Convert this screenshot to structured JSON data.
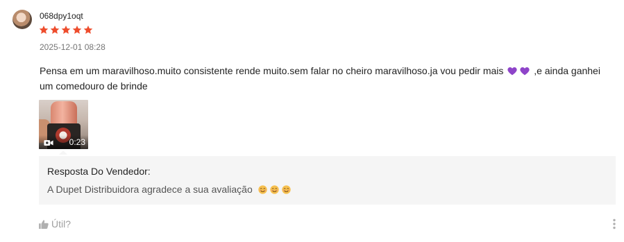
{
  "review": {
    "username": "068dpy1oqt",
    "rating": 5,
    "rating_max": 5,
    "date": "2025-12-01 08:28",
    "text_part1": "Pensa em um maravilhoso.muito consistente rende muito.sem falar no cheiro maravilhoso.ja vou pedir mais ",
    "text_emoji": "purple-heart",
    "text_part2": " ,e ainda ganhei um comedouro de brinde",
    "media": {
      "type": "video",
      "duration": "0:23"
    }
  },
  "seller_reply": {
    "title": "Resposta Do Vendedor:",
    "text": "A Dupet Distribuidora agradece a sua avaliação",
    "emoji": "smiling-face"
  },
  "actions": {
    "helpful_label": "Útil?",
    "more_icon": "more-vertical-icon"
  },
  "colors": {
    "star": "#ee4d2d",
    "reply_bg": "#f5f5f5",
    "muted": "#757575",
    "heart": "#8e44c9"
  }
}
